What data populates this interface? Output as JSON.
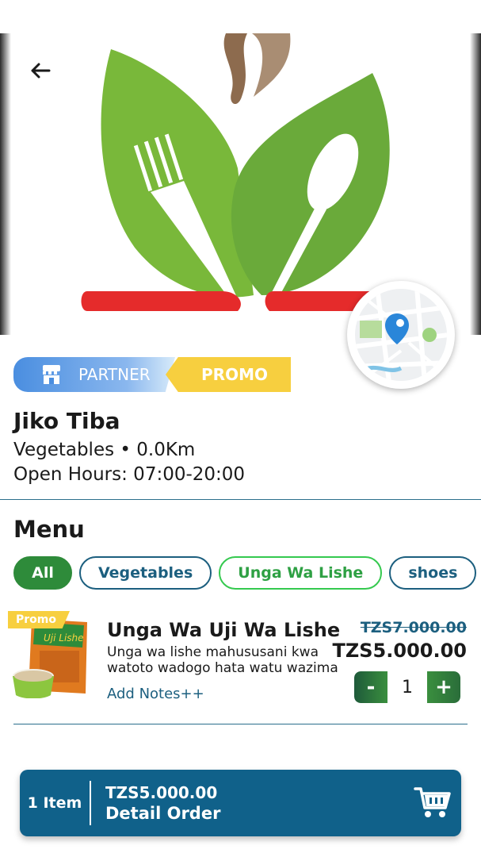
{
  "header": {
    "back_icon": "arrow-left-icon",
    "map_icon": "map-location-icon"
  },
  "store": {
    "badges": {
      "partner_icon": "storefront-icon",
      "partner_label": "PARTNER",
      "promo_label": "PROMO"
    },
    "name": "Jiko Tiba",
    "subtitle": "Vegetables • 0.0Km",
    "hours": "Open Hours: 07:00-20:00"
  },
  "menu": {
    "title": "Menu",
    "categories": [
      {
        "label": "All",
        "state": "selected"
      },
      {
        "label": "Vegetables",
        "state": "default"
      },
      {
        "label": "Unga Wa Lishe",
        "state": "highlighted"
      },
      {
        "label": "shoes",
        "state": "default"
      }
    ],
    "items": [
      {
        "promo_tag": "Promo",
        "name": "Unga Wa Uji Wa Lishe",
        "description": "Unga wa lishe mahususani kwa watoto wadogo hata watu wazima",
        "add_notes": "Add Notes++",
        "old_price": "TZS7.000.00",
        "price": "TZS5.000.00",
        "quantity": "1",
        "minus_label": "-",
        "plus_label": "+"
      }
    ]
  },
  "order_bar": {
    "count": "1 Item",
    "total": "TZS5.000.00",
    "detail": "Detail Order",
    "cart_icon": "cart-icon"
  },
  "colors": {
    "primary": "#10618a",
    "green": "#2e8b3a",
    "promo_yellow": "#f7cf3f",
    "partner_blue": "#4a8ee0"
  }
}
